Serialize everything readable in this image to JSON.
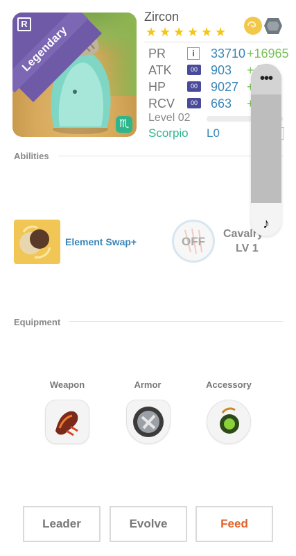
{
  "card": {
    "name": "Zircon",
    "rarity_label": "Legendary",
    "rarity_letter": "R",
    "star_count": 6,
    "star_glyph": "★",
    "zodiac_glyph": "♏",
    "element_icons": [
      "wind-element-icon",
      "earth-element-icon"
    ]
  },
  "stats": {
    "pr": {
      "label": "PR",
      "badge": "i",
      "value": "33710",
      "bonus": "+16965"
    },
    "atk": {
      "label": "ATK",
      "badge": "00",
      "value": "903",
      "bonus": "+4"
    },
    "hp": {
      "label": "HP",
      "badge": "00",
      "value": "9027",
      "bonus": "+"
    },
    "rcv": {
      "label": "RCV",
      "badge": "00",
      "value": "663",
      "bonus": "+"
    },
    "level": "Level 02",
    "level_progress": 0.0,
    "zodiac_name": "Scorpio",
    "zodiac_level": "L0"
  },
  "overlay": {
    "menu_glyph": "•••",
    "note_glyph": "♪"
  },
  "abilities": {
    "title": "Abilities",
    "skill_name": "Element Swap+",
    "leader_toggle": "OFF",
    "leader_skill_name": "Cavalry",
    "leader_skill_level": "LV 1"
  },
  "equipment": {
    "title": "Equipment",
    "slots": [
      {
        "label": "Weapon",
        "icon": "weapon-claw-icon"
      },
      {
        "label": "Armor",
        "icon": "armor-shield-icon"
      },
      {
        "label": "Accessory",
        "icon": "accessory-orb-icon"
      }
    ]
  },
  "actions": {
    "leader": "Leader",
    "evolve": "Evolve",
    "feed": "Feed"
  },
  "colors": {
    "legendary": "#7b67b3",
    "stat_value": "#3a86b8",
    "stat_bonus": "#79c257",
    "zodiac": "#2fb58c",
    "feed": "#e2622a"
  }
}
